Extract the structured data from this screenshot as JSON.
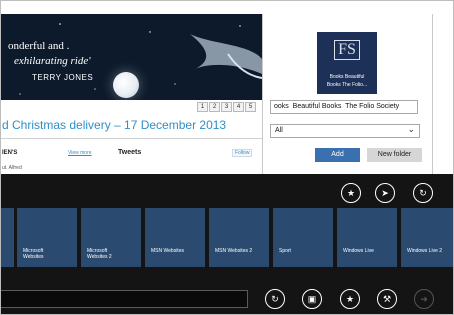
{
  "hero": {
    "line1": "onderful and .",
    "line2": "exhilarating ride'",
    "author": "TERRY JONES"
  },
  "pager": [
    "1",
    "2",
    "3",
    "4",
    "5"
  ],
  "delivery_text": "d Christmas delivery – 17 December 2013",
  "news": {
    "heading": "IEN'S",
    "view_more": "View more",
    "tweets": "Tweets",
    "follow": "Follow",
    "item": "ut. Alfred"
  },
  "pin_panel": {
    "logo_monogram": "FS",
    "logo_line1": "Books Beautiful",
    "logo_line2": "Books The Folio...",
    "name_value": "ooks  Beautiful Books  The Folio Society",
    "folder_value": "All",
    "add_label": "Add",
    "new_folder_label": "New folder"
  },
  "app_bar": {
    "top_icons": [
      "favorite-star-icon",
      "pin-icon",
      "forward-icon"
    ],
    "tiles": [
      {
        "line1": "",
        "line2": ""
      },
      {
        "line1": "Microsoft",
        "line2": "Websites"
      },
      {
        "line1": "Microsoft",
        "line2": "Websites 2"
      },
      {
        "line1": "MSN Websites",
        "line2": ""
      },
      {
        "line1": "MSN Websites 2",
        "line2": ""
      },
      {
        "line1": "Sport",
        "line2": ""
      },
      {
        "line1": "Windows Live",
        "line2": ""
      },
      {
        "line1": "Windows Live 2",
        "line2": ""
      }
    ],
    "bottom_icons": [
      "refresh-icon",
      "tabs-icon",
      "favorites-icon",
      "tools-icon",
      "go-arrow-icon"
    ]
  },
  "colors": {
    "app_bar_bg": "#141414",
    "tile_bg": "#2b4a70",
    "accent_button": "#3a6fb0",
    "link_blue": "#2f8fc7"
  }
}
